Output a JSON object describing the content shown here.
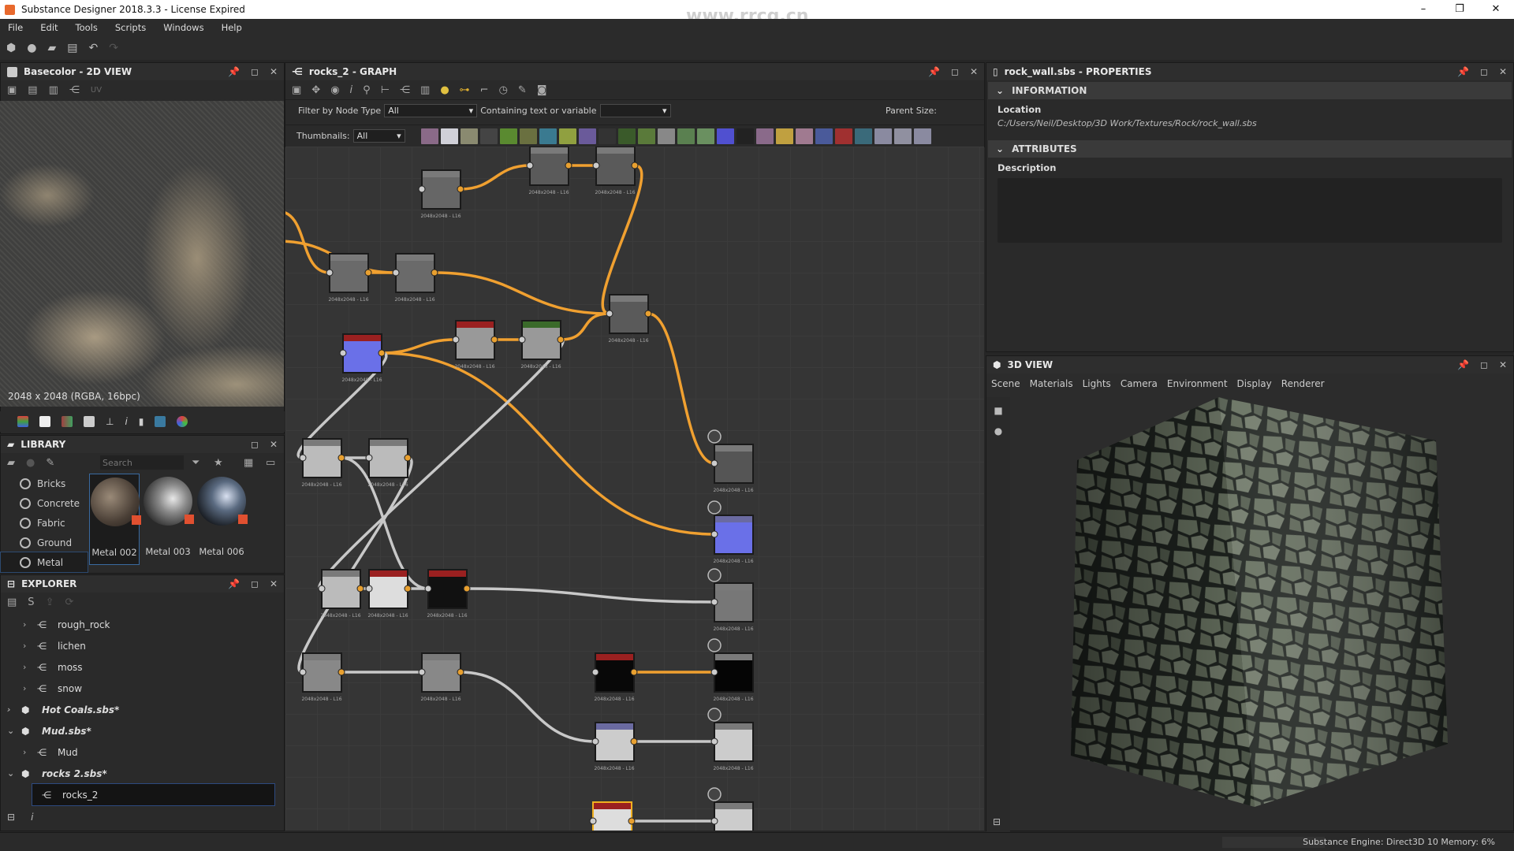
{
  "window": {
    "title": "Substance Designer 2018.3.3 - License Expired",
    "controls": [
      "–",
      "❐",
      "✕"
    ]
  },
  "menu": [
    "File",
    "Edit",
    "Tools",
    "Scripts",
    "Windows",
    "Help"
  ],
  "view2d": {
    "title": "Basecolor - 2D VIEW",
    "uv_label": "UV",
    "info": "2048 x 2048 (RGBA, 16bpc)"
  },
  "library": {
    "title": "LIBRARY",
    "search_placeholder": "Search",
    "categories": [
      "Bricks",
      "Concrete",
      "Fabric",
      "Ground",
      "Metal"
    ],
    "selected_category": "Metal",
    "items": [
      {
        "name": "Metal 002",
        "selected": true
      },
      {
        "name": "Metal 003",
        "selected": false
      },
      {
        "name": "Metal 006",
        "selected": false
      }
    ]
  },
  "explorer": {
    "title": "EXPLORER",
    "tree": [
      {
        "label": "rough_rock",
        "type": "graph",
        "level": 1,
        "expanded": false
      },
      {
        "label": "lichen",
        "type": "graph",
        "level": 1,
        "expanded": false
      },
      {
        "label": "moss",
        "type": "graph",
        "level": 1,
        "expanded": false
      },
      {
        "label": "snow",
        "type": "graph",
        "level": 1,
        "expanded": false
      },
      {
        "label": "Hot Coals.sbs*",
        "type": "package",
        "level": 0,
        "expanded": false
      },
      {
        "label": "Mud.sbs*",
        "type": "package",
        "level": 0,
        "expanded": true
      },
      {
        "label": "Mud",
        "type": "graph",
        "level": 1,
        "expanded": false
      },
      {
        "label": "rocks 2.sbs*",
        "type": "package",
        "level": 0,
        "expanded": true
      },
      {
        "label": "rocks_2",
        "type": "graph",
        "level": 1,
        "expanded": false,
        "selected": true
      }
    ]
  },
  "graph": {
    "title": "rocks_2 - GRAPH",
    "filter_label": "Filter by Node Type",
    "filter_value": "All",
    "containing_label": "Containing text or variable",
    "containing_value": "",
    "parent_size_label": "Parent Size:",
    "thumbnails_label": "Thumbnails:",
    "thumbnails_value": "All",
    "node_filter_colors": [
      "#8a6a88",
      "#d0d0d8",
      "#8a8a70",
      "#444444",
      "#5a8a30",
      "#6a7040",
      "#3a7a90",
      "#90a040",
      "#6a5a9a",
      "#333333",
      "#3a5a2a",
      "#5a7a3a",
      "#888888",
      "#5a8050",
      "#6a9060",
      "#5050d0",
      "#222222",
      "#8a6a8a",
      "#c0a040",
      "#a07a90",
      "#4a5a9a",
      "#a03030",
      "#3a6a7a",
      "#8a8aa0",
      "#9090a0",
      "#8a8aa0"
    ],
    "node_resolution": "2048x2048 - L16",
    "wire_colors": {
      "active": "#f0a030",
      "inactive": "#c8c8c8"
    },
    "node_header_colors": {
      "red": "#9a2020",
      "green": "#3a6a2a",
      "gray": "#7a7a7a",
      "blue": "#6a6aa0"
    }
  },
  "properties": {
    "title": "rock_wall.sbs - PROPERTIES",
    "sections": [
      {
        "title": "INFORMATION",
        "fields": [
          {
            "label": "Location",
            "value": "C:/Users/Neil/Desktop/3D Work/Textures/Rock/rock_wall.sbs"
          }
        ]
      },
      {
        "title": "ATTRIBUTES",
        "fields": [
          {
            "label": "Description",
            "value": ""
          }
        ]
      }
    ]
  },
  "view3d": {
    "title": "3D VIEW",
    "tabs": [
      "Scene",
      "Materials",
      "Lights",
      "Camera",
      "Environment",
      "Display",
      "Renderer"
    ]
  },
  "status": {
    "text": "Substance Engine: Direct3D 10  Memory: 6%"
  },
  "watermark": "www.rrcg.cn"
}
